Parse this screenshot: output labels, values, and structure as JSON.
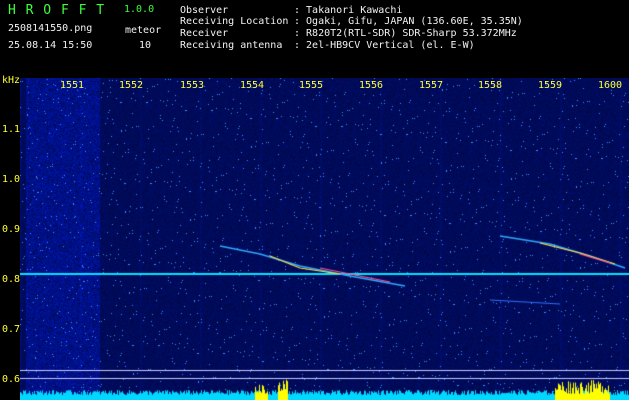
{
  "header": {
    "app_name": "H R O F F T",
    "version": "1.0.0",
    "filename": "2508141550.png",
    "datetime": "25.08.14 15:50",
    "meteor_label": "meteor",
    "meteor_count": "10",
    "info": [
      {
        "label": "Observer",
        "value": ": Takanori Kawachi"
      },
      {
        "label": "Receiving Location",
        "value": ": Ogaki, Gifu, JAPAN (136.60E, 35.35N)"
      },
      {
        "label": "Receiver",
        "value": ": R820T2(RTL-SDR) SDR-Sharp 53.372MHz"
      },
      {
        "label": "Receiving antenna",
        "value": ": 2el-HB9CV Vertical (el. E-W)"
      }
    ]
  },
  "axes": {
    "y_unit": "kHz",
    "x_ticks": [
      "1551",
      "1552",
      "1553",
      "1554",
      "1555",
      "1556",
      "1557",
      "1558",
      "1559",
      "1600"
    ],
    "y_ticks": [
      "1.1",
      "1.0",
      "0.9",
      "0.8",
      "0.7",
      "0.6"
    ]
  },
  "colors": {
    "header_green": "#3cff3c",
    "header_yellow": "#ffff33",
    "axis_yellow": "#ffff33",
    "spectrum_bg": "#00005a",
    "carrier": "#00e5ff",
    "noise_floor": "#00d8ff",
    "burst": "#ffff00"
  }
}
